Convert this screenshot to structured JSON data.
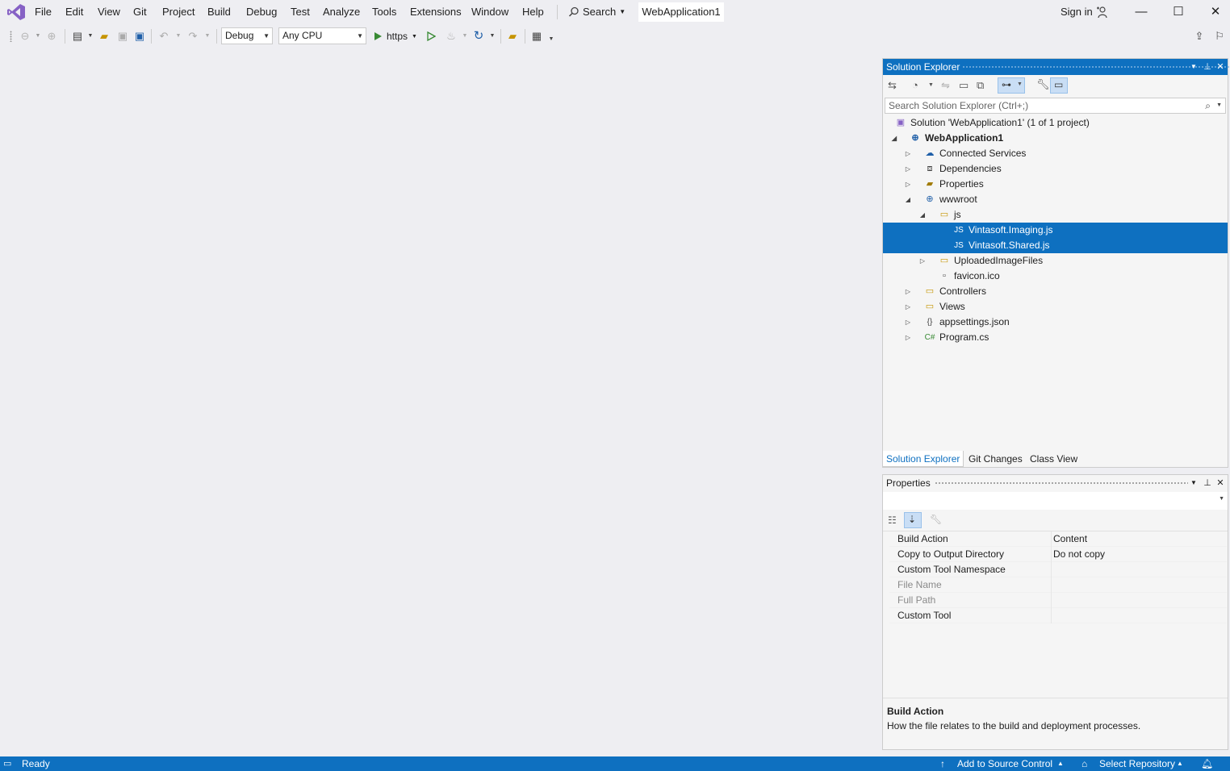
{
  "menu": {
    "items": [
      "File",
      "Edit",
      "View",
      "Git",
      "Project",
      "Build",
      "Debug",
      "Test",
      "Analyze",
      "Tools",
      "Extensions",
      "Window",
      "Help"
    ],
    "search_label": "Search",
    "project_title": "WebApplication1",
    "sign_in": "Sign in"
  },
  "toolbar": {
    "config": "Debug",
    "platform": "Any CPU",
    "run_target": "https"
  },
  "solution_explorer": {
    "title": "Solution Explorer",
    "search_placeholder": "Search Solution Explorer (Ctrl+;)",
    "tree": [
      {
        "label": "Solution 'WebApplication1' (1 of 1 project)",
        "icon": "solution-icon"
      },
      {
        "label": "WebApplication1",
        "icon": "web-project-icon"
      },
      {
        "label": "Connected Services",
        "icon": "connected-services-icon"
      },
      {
        "label": "Dependencies",
        "icon": "dependencies-icon"
      },
      {
        "label": "Properties",
        "icon": "properties-folder-icon"
      },
      {
        "label": "wwwroot",
        "icon": "globe-icon"
      },
      {
        "label": "js",
        "icon": "folder-icon"
      },
      {
        "label": "Vintasoft.Imaging.js",
        "icon": "js-file-icon",
        "selected": true
      },
      {
        "label": "Vintasoft.Shared.js",
        "icon": "js-file-icon",
        "selected": true
      },
      {
        "label": "UploadedImageFiles",
        "icon": "folder-icon"
      },
      {
        "label": "favicon.ico",
        "icon": "ico-file-icon"
      },
      {
        "label": "Controllers",
        "icon": "folder-icon"
      },
      {
        "label": "Views",
        "icon": "folder-icon"
      },
      {
        "label": "appsettings.json",
        "icon": "json-file-icon"
      },
      {
        "label": "Program.cs",
        "icon": "csharp-file-icon"
      }
    ],
    "tabs": [
      "Solution Explorer",
      "Git Changes",
      "Class View"
    ]
  },
  "properties": {
    "title": "Properties",
    "rows": [
      {
        "name": "Build Action",
        "value": "Content"
      },
      {
        "name": "Copy to Output Directory",
        "value": "Do not copy"
      },
      {
        "name": "Custom Tool Namespace",
        "value": ""
      },
      {
        "name": "File Name",
        "value": ""
      },
      {
        "name": "Full Path",
        "value": ""
      },
      {
        "name": "Custom Tool",
        "value": ""
      }
    ],
    "desc_title": "Build Action",
    "desc_text": "How the file relates to the build and deployment processes."
  },
  "status": {
    "ready": "Ready",
    "source_control": "Add to Source Control",
    "repository": "Select Repository"
  },
  "colors": {
    "accent": "#0e70c0",
    "background": "#eeeef2",
    "vs_purple": "#8661c5"
  }
}
